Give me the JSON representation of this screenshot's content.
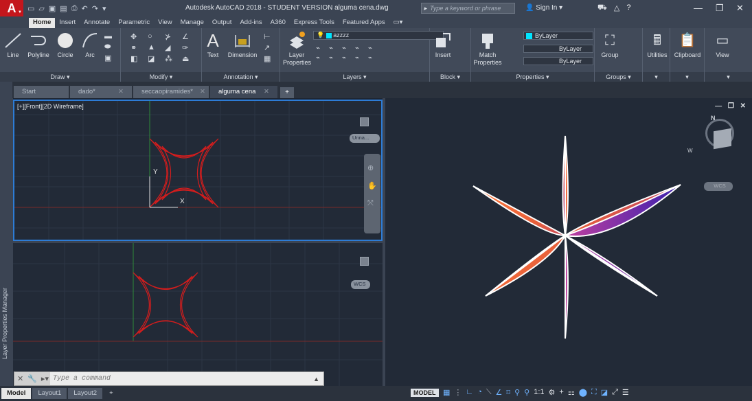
{
  "app": {
    "logo": "A",
    "title": "Autodesk AutoCAD 2018 - STUDENT VERSION   alguma cena.dwg",
    "search_placeholder": "Type a keyword or phrase",
    "signin": "Sign In"
  },
  "ribbon_tabs": [
    "Home",
    "Insert",
    "Annotate",
    "Parametric",
    "View",
    "Manage",
    "Output",
    "Add-ins",
    "A360",
    "Express Tools",
    "Featured Apps"
  ],
  "panels": {
    "draw": {
      "title": "Draw ▾",
      "line": "Line",
      "polyline": "Polyline",
      "circle": "Circle",
      "arc": "Arc"
    },
    "modify": {
      "title": "Modify ▾"
    },
    "annotation": {
      "title": "Annotation ▾",
      "text": "Text",
      "dimension": "Dimension"
    },
    "layers": {
      "title": "Layers ▾",
      "layer_properties_1": "Layer",
      "layer_properties_2": "Properties",
      "current_layer": "azzzz"
    },
    "block": {
      "title": "Block ▾",
      "insert": "Insert"
    },
    "properties": {
      "title": "Properties ▾",
      "match_1": "Match",
      "match_2": "Properties",
      "color": "ByLayer",
      "linetype": "ByLayer",
      "lineweight": "ByLayer"
    },
    "groups": {
      "title": "Groups ▾",
      "group": "Group"
    },
    "utilities": {
      "label": "Utilities"
    },
    "clipboard": {
      "label": "Clipboard"
    },
    "view": {
      "label": "View"
    }
  },
  "doc_tabs": [
    {
      "label": "Start",
      "active": false
    },
    {
      "label": "dado*",
      "active": false
    },
    {
      "label": "seccaopiramides*",
      "active": false
    },
    {
      "label": "alguma cena",
      "active": true
    }
  ],
  "side_panel_label": "Layer Properties Manager",
  "viewport1": {
    "label": "[+][Front][2D Wireframe]",
    "named_view": "Unna...",
    "ucs_y": "Y",
    "ucs_x": "X"
  },
  "viewport2": {
    "named_view": "WCS"
  },
  "viewport3": {
    "compass_n": "N",
    "compass_w": "W",
    "wcs": "WCS"
  },
  "command": {
    "placeholder": "Type a command"
  },
  "layout_tabs": [
    {
      "label": "Model",
      "active": true
    },
    {
      "label": "Layout1",
      "active": false
    },
    {
      "label": "Layout2",
      "active": false
    }
  ],
  "status": {
    "model": "MODEL",
    "scale": "1:1"
  },
  "colors": {
    "accent": "#2d7cd6",
    "star_red": "#d41d1d",
    "autocad_red": "#c4161c"
  }
}
